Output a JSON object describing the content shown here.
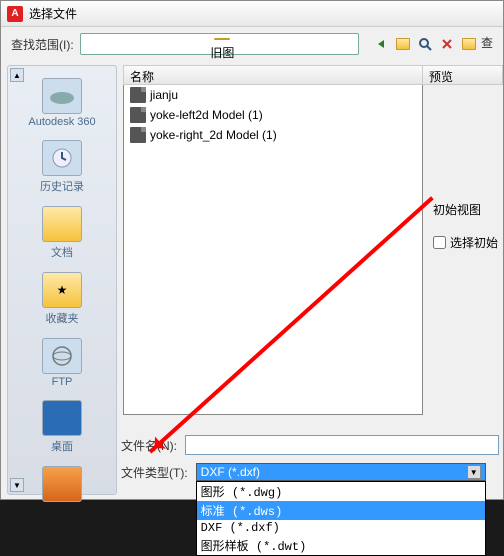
{
  "title": "选择文件",
  "toolbar": {
    "lookin_label": "查找范围(I):",
    "lookin_value": "旧图"
  },
  "nav_icons": [
    "back",
    "up",
    "search",
    "delete",
    "new",
    "views"
  ],
  "columns": {
    "name": "名称",
    "preview": "预览"
  },
  "files": [
    {
      "name": "jianju"
    },
    {
      "name": "yoke-left2d Model (1)"
    },
    {
      "name": "yoke-right_2d Model (1)"
    }
  ],
  "sidebar": [
    {
      "id": "autodesk",
      "label": "Autodesk 360"
    },
    {
      "id": "history",
      "label": "历史记录"
    },
    {
      "id": "docs",
      "label": "文档"
    },
    {
      "id": "fav",
      "label": "收藏夹"
    },
    {
      "id": "ftp",
      "label": "FTP"
    },
    {
      "id": "desktop",
      "label": "桌面"
    }
  ],
  "right": {
    "initview_label": "初始视图",
    "checkbox_label": "选择初始"
  },
  "bottom": {
    "filename_label": "文件名(N):",
    "filetype_label": "文件类型(T):",
    "filetype_selected": "DXF (*.dxf)",
    "filetype_options": [
      {
        "text": "图形 (*.dwg)",
        "hl": false
      },
      {
        "text": "标准 (*.dws)",
        "hl": true
      },
      {
        "text": "DXF (*.dxf)",
        "hl": false
      },
      {
        "text": "图形样板 (*.dwt)",
        "hl": false
      }
    ]
  },
  "truncated_right_btn": "查"
}
